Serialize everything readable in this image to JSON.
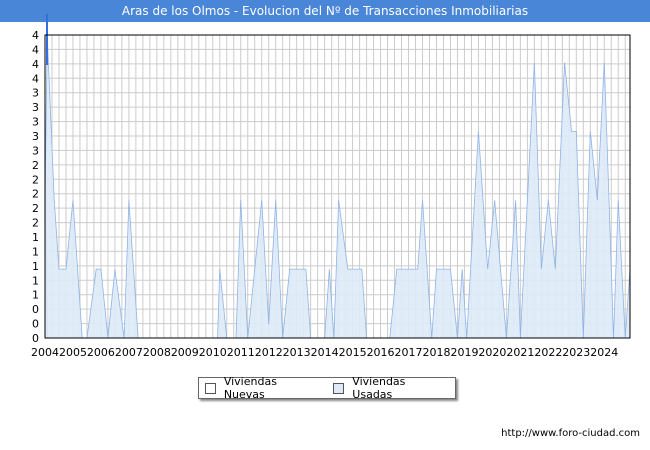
{
  "header": {
    "title": "Aras de los Olmos - Evolucion del Nº de Transacciones Inmobiliarias"
  },
  "footer": {
    "url": "http://www.foro-ciudad.com"
  },
  "colors": {
    "title_bg": "#4a86d8",
    "series_fill": "#deeaf8",
    "series_stroke": "#8fb3e6",
    "grid": "#cccccc"
  },
  "chart_data": {
    "type": "area",
    "title": "Aras de los Olmos - Evolucion del Nº de Transacciones Inmobiliarias",
    "xlabel": "",
    "ylabel": "",
    "x_ticks": [
      "2004",
      "2005",
      "2006",
      "2007",
      "2008",
      "2009",
      "2010",
      "2011",
      "2012",
      "2013",
      "2014",
      "2015",
      "2016",
      "2017",
      "2018",
      "2019",
      "2020",
      "2021",
      "2022",
      "2023",
      "2024"
    ],
    "y_ticks": [
      "0",
      "0",
      "0",
      "1",
      "1",
      "1",
      "1",
      "1",
      "2",
      "2",
      "2",
      "2",
      "2",
      "3",
      "3",
      "3",
      "3",
      "3",
      "4",
      "4",
      "4",
      "4"
    ],
    "ylim": [
      0,
      4.4
    ],
    "xlim": [
      2004,
      2024.92
    ],
    "grid": true,
    "legend_position": "bottom",
    "legend": [
      "Viviendas Nuevas",
      "Viviendas Usadas"
    ],
    "series": [
      {
        "name": "Viviendas Nuevas",
        "points": [
          [
            2004.0,
            2.8
          ],
          [
            2004.08,
            0
          ]
        ]
      },
      {
        "name": "Viviendas Usadas",
        "points": [
          [
            2004.0,
            2.0
          ],
          [
            2004.08,
            4.4
          ],
          [
            2004.33,
            2.0
          ],
          [
            2004.5,
            1.0
          ],
          [
            2004.75,
            1.0
          ],
          [
            2005.0,
            2.0
          ],
          [
            2005.33,
            0
          ],
          [
            2005.5,
            0
          ],
          [
            2005.83,
            1.0
          ],
          [
            2006.0,
            1.0
          ],
          [
            2006.25,
            0
          ],
          [
            2006.5,
            1.0
          ],
          [
            2006.83,
            0
          ],
          [
            2007.0,
            2.0
          ],
          [
            2007.33,
            0
          ],
          [
            2010.17,
            0
          ],
          [
            2010.25,
            1.0
          ],
          [
            2010.5,
            0
          ],
          [
            2010.83,
            0
          ],
          [
            2011.0,
            2.0
          ],
          [
            2011.25,
            0
          ],
          [
            2011.75,
            2.0
          ],
          [
            2012.0,
            0.2
          ],
          [
            2012.25,
            2.0
          ],
          [
            2012.5,
            0
          ],
          [
            2012.75,
            1.0
          ],
          [
            2013.33,
            1.0
          ],
          [
            2013.5,
            0
          ],
          [
            2014.0,
            0
          ],
          [
            2014.17,
            1.0
          ],
          [
            2014.33,
            0
          ],
          [
            2014.5,
            2.0
          ],
          [
            2014.83,
            1.0
          ],
          [
            2015.33,
            1.0
          ],
          [
            2015.5,
            0
          ],
          [
            2016.33,
            0
          ],
          [
            2016.58,
            1.0
          ],
          [
            2017.33,
            1.0
          ],
          [
            2017.5,
            2.0
          ],
          [
            2017.83,
            0
          ],
          [
            2018.0,
            1.0
          ],
          [
            2018.5,
            1.0
          ],
          [
            2018.75,
            0
          ],
          [
            2018.92,
            1.0
          ],
          [
            2019.08,
            0
          ],
          [
            2019.5,
            3.0
          ],
          [
            2019.83,
            1.0
          ],
          [
            2020.08,
            2.0
          ],
          [
            2020.5,
            0
          ],
          [
            2020.83,
            2.0
          ],
          [
            2021.0,
            0
          ],
          [
            2021.5,
            4.0
          ],
          [
            2021.75,
            1.0
          ],
          [
            2022.0,
            2.0
          ],
          [
            2022.25,
            1.0
          ],
          [
            2022.58,
            4.0
          ],
          [
            2022.83,
            3.0
          ],
          [
            2023.0,
            3.0
          ],
          [
            2023.25,
            0
          ],
          [
            2023.5,
            3.0
          ],
          [
            2023.75,
            2.0
          ],
          [
            2024.0,
            4.0
          ],
          [
            2024.17,
            2.0
          ],
          [
            2024.33,
            0
          ],
          [
            2024.5,
            2.0
          ],
          [
            2024.75,
            0
          ],
          [
            2024.92,
            1.0
          ]
        ]
      }
    ]
  }
}
